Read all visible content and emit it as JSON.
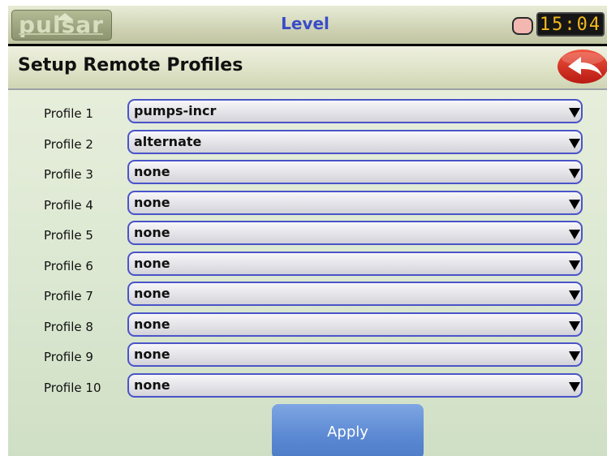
{
  "topbar": {
    "logo_text": "pulsar",
    "title": "Level",
    "clock": "15:04",
    "status_led_color": "#f2b7b1",
    "clock_color": "#f3ba1a"
  },
  "header": {
    "title": "Setup Remote Profiles",
    "back_icon": "back-arrow-icon"
  },
  "profiles": [
    {
      "label": "Profile 1",
      "value": "pumps-incr"
    },
    {
      "label": "Profile 2",
      "value": "alternate"
    },
    {
      "label": "Profile 3",
      "value": "none"
    },
    {
      "label": "Profile 4",
      "value": "none"
    },
    {
      "label": "Profile 5",
      "value": "none"
    },
    {
      "label": "Profile 6",
      "value": "none"
    },
    {
      "label": "Profile 7",
      "value": "none"
    },
    {
      "label": "Profile 8",
      "value": "none"
    },
    {
      "label": "Profile 9",
      "value": "none"
    },
    {
      "label": "Profile 10",
      "value": "none"
    }
  ],
  "apply_label": "Apply",
  "colors": {
    "accent": "#3a4cc8",
    "select_border": "#4a54c8",
    "apply_button": "#5b88d2",
    "back_button": "#d8281d"
  }
}
